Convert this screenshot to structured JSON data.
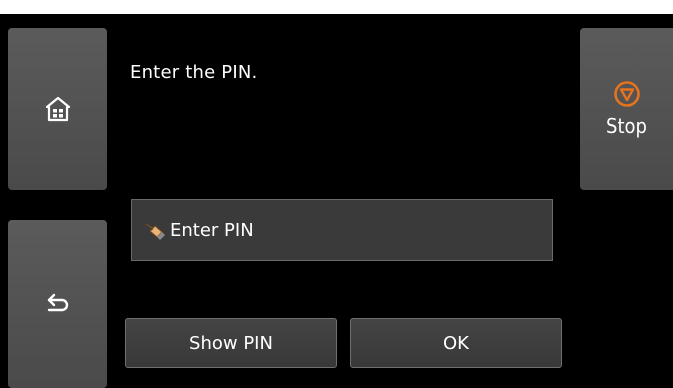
{
  "screen": {
    "message": "Enter the PIN."
  },
  "left_panel": {
    "home_icon": "home-icon",
    "back_icon": "back-icon"
  },
  "stop": {
    "label": "Stop",
    "icon": "stop-icon",
    "icon_color": "#e8731c"
  },
  "pin_input": {
    "placeholder": "Enter PIN",
    "icon": "pointing-hand-icon"
  },
  "buttons": {
    "show_pin": "Show PIN",
    "ok": "OK"
  }
}
